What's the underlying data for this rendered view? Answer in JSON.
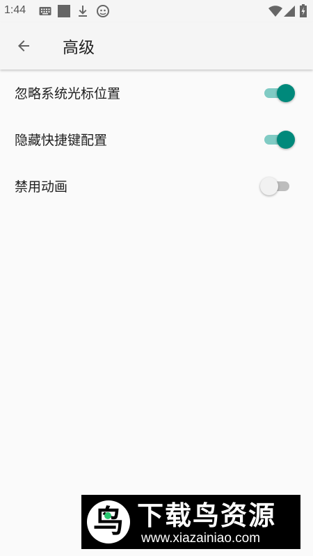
{
  "status_bar": {
    "time": "1:44",
    "icons": [
      "keyboard-icon",
      "square-notification-icon",
      "download-icon",
      "android-head-icon",
      "wifi-icon",
      "signal-icon",
      "battery-icon"
    ]
  },
  "app_bar": {
    "back_icon": "arrow-left-icon",
    "title": "高级"
  },
  "settings": [
    {
      "label": "忽略系统光标位置",
      "enabled": true
    },
    {
      "label": "隐藏快捷键配置",
      "enabled": true
    },
    {
      "label": "禁用动画",
      "enabled": false
    }
  ],
  "colors": {
    "accent": "#00897b",
    "accent_track": "#80cbc4",
    "background": "#fafafa",
    "app_bar": "#f5f5f5"
  },
  "watermark": {
    "title": "下载鸟资源",
    "url": "www.xiazainiao.com"
  }
}
